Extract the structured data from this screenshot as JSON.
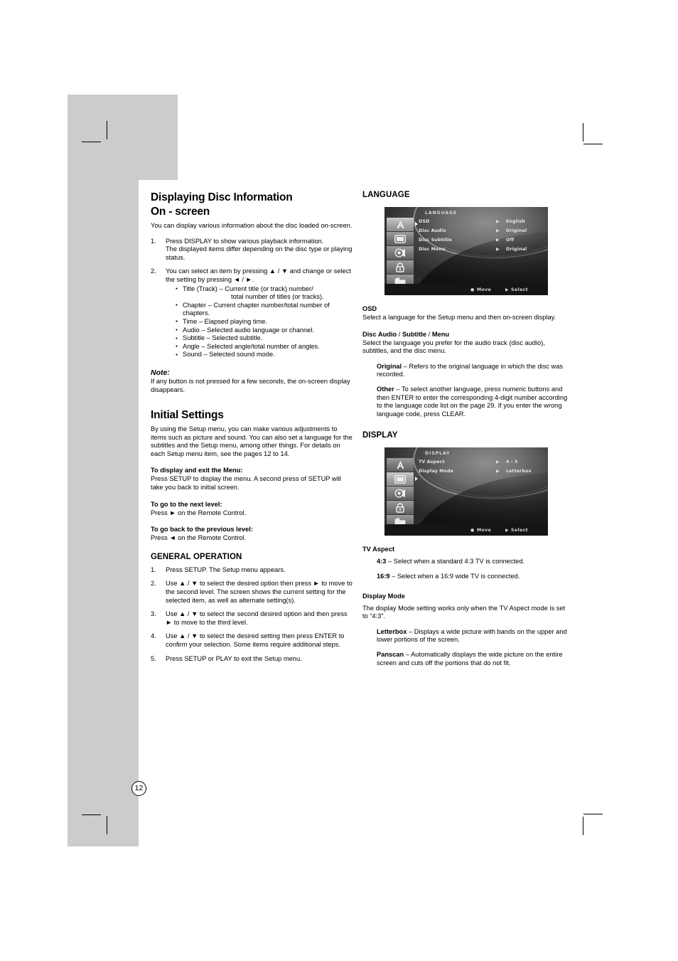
{
  "page": {
    "number": "12"
  },
  "left_column": {
    "title_line1": "Displaying Disc Information",
    "title_line2": "On - screen",
    "intro": "You can display various information about the disc loaded on-screen.",
    "steps": [
      {
        "num": "1.",
        "lines": [
          "Press DISPLAY to show various playback information.",
          "The displayed items differ depending on the disc type or playing status."
        ]
      },
      {
        "num": "2.",
        "lines": [
          "You can select an item by pressing ▲ / ▼ and change or select the setting by pressing ◄ / ►."
        ]
      }
    ],
    "bullets": [
      {
        "text": "Title (Track) –  Current title (or track) number/",
        "cont": "total number of titles (or tracks)."
      },
      {
        "text": "Chapter – Current chapter number/total number of chapters.",
        "cont": ""
      },
      {
        "text": "Time – Elapsed playing time.",
        "cont": ""
      },
      {
        "text": "Audio – Selected audio language or channel.",
        "cont": ""
      },
      {
        "text": "Subtitle – Selected subtitle.",
        "cont": ""
      },
      {
        "text": "Angle – Selected angle/total number of angles.",
        "cont": ""
      },
      {
        "text": "Sound – Selected sound mode.",
        "cont": ""
      }
    ],
    "note_head": "Note:",
    "note_body": "If any button is not pressed for a few seconds, the on-screen display disappears.",
    "initial_settings_title": "Initial Settings",
    "initial_settings_body": "By using the Setup menu, you can make various adjustments to items such as picture and sound. You can also set a language for the subtitles and the Setup menu, among other things. For details on each Setup menu item, see  the pages 12 to 14.",
    "display_exit_head": "To display and exit the Menu:",
    "display_exit_body": "Press SETUP to display the menu. A second press of SETUP will take you back to initial screen.",
    "next_level_head": "To go to the next level:",
    "next_level_body": "Press ► on the Remote Control.",
    "prev_level_head": "To go back to the previous level:",
    "prev_level_body": "Press ◄ on the Remote Control.",
    "general_operation_head": "GENERAL OPERATION",
    "general_steps": [
      {
        "num": "1.",
        "text": "Press SETUP. The Setup menu appears."
      },
      {
        "num": "2.",
        "text": "Use ▲ / ▼ to select the desired option then press ► to move to the second level. The screen shows the current setting for the selected item, as well as alternate setting(s)."
      },
      {
        "num": "3.",
        "text": "Use ▲ / ▼ to select the second desired option and then press ► to move to the third level."
      },
      {
        "num": "4.",
        "text": "Use ▲ / ▼ to select the desired setting then press ENTER to confirm your selection. Some items require additional steps."
      },
      {
        "num": "5.",
        "text": "Press SETUP or PLAY to exit the Setup menu."
      }
    ]
  },
  "right_column": {
    "language_head": "LANGUAGE",
    "language_osd": {
      "title": "LANGUAGE",
      "sidebar_icons": [
        "language-icon",
        "display-icon",
        "audio-icon",
        "lock-icon",
        "others-icon"
      ],
      "selected_index": 0,
      "rows": [
        {
          "label": "OSD",
          "marker": "▶",
          "value": "English"
        },
        {
          "label": "Disc Audio",
          "marker": "▶",
          "value": "Original"
        },
        {
          "label": "Disc Subtitle",
          "marker": "▶",
          "value": "Off"
        },
        {
          "label": "Disc Menu",
          "marker": "▶",
          "value": "Original"
        }
      ],
      "footer_move": "Move",
      "footer_select": "Select"
    },
    "osd_head": "OSD",
    "osd_body": "Select a language for the Setup menu and then on-screen display.",
    "disc_audio_head_parts": [
      "Disc Audio",
      " / ",
      "Subtitle",
      " / ",
      "Menu"
    ],
    "disc_audio_body": "Select the language you prefer for the audio track (disc audio), subtitles, and the disc menu.",
    "original_term": "Original",
    "original_def": " – Refers to the original language in which the disc was recorded.",
    "other_term": "Other",
    "other_def": " – To select another language, press numeric buttons and then ENTER to enter the corresponding 4-digit number according to the language code list on the page 29. If you enter the wrong language code, press CLEAR.",
    "display_head": "DISPLAY",
    "display_osd": {
      "title": "DISPLAY",
      "sidebar_icons": [
        "language-icon",
        "display-icon",
        "audio-icon",
        "lock-icon",
        "others-icon"
      ],
      "selected_index": 1,
      "rows": [
        {
          "label": "TV Aspect",
          "marker": "▶",
          "value": "4 : 3"
        },
        {
          "label": "Display Mode",
          "marker": "▶",
          "value": "Letterbox"
        }
      ],
      "footer_move": "Move",
      "footer_select": "Select"
    },
    "tv_aspect_head": "TV Aspect",
    "tv_43_term": "4:3",
    "tv_43_def": " – Select when a standard 4:3 TV is connected.",
    "tv_169_term": "16:9",
    "tv_169_def": " – Select when a 16:9 wide TV is connected.",
    "display_mode_head": "Display Mode",
    "display_mode_body": "The display Mode setting works only when the TV Aspect mode is set to “4:3”.",
    "letterbox_term": "Letterbox",
    "letterbox_def": " – Displays a wide picture with bands on the upper and lower portions of the screen.",
    "panscan_term": "Panscan",
    "panscan_def": " – Automatically displays the wide picture on the entire screen and cuts off the portions that do not fit."
  }
}
